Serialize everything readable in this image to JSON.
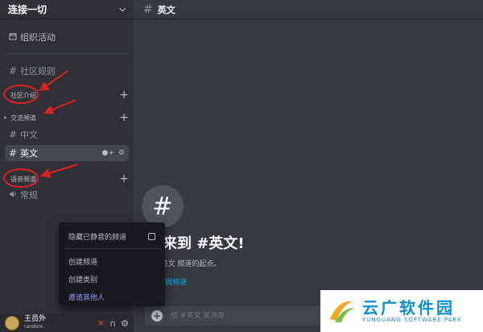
{
  "server": {
    "name": "连接一切"
  },
  "sidebar": {
    "events_label": "组织活动",
    "rules_channel": "社区规则",
    "categories": [
      {
        "label": "社区介绍"
      },
      {
        "label": "交流频道"
      },
      {
        "label": "语音频道"
      }
    ],
    "text_channels": [
      {
        "label": "中文"
      },
      {
        "label": "英文"
      }
    ],
    "voice_channel": "常规"
  },
  "user": {
    "name": "王员外",
    "tag": "random"
  },
  "context_menu": {
    "items": [
      {
        "label": "隐藏已静音的频道"
      },
      {
        "label": "创建频道"
      },
      {
        "label": "创建类别"
      },
      {
        "label": "邀请其他人"
      }
    ]
  },
  "main": {
    "channel_name": "英文",
    "welcome_title": "迎来到 #英文!",
    "welcome_subtitle": "#英文 频道的起点。",
    "edit_channel_link": "编辑频道",
    "message_placeholder": "给 #英文 发消息"
  },
  "watermark": {
    "cn": "云广软件园",
    "en": "YUNGUANG SOFTWARE PARK"
  },
  "colors": {
    "sidebar_bg": "#2f3136",
    "main_bg": "#36393f",
    "annotation_red": "#e02020",
    "link_blue": "#00aff4",
    "invite_purple": "#949cf7",
    "watermark_blue": "#0a8fd6"
  },
  "icons": {
    "events": "calendar-icon",
    "channel": "hash-icon",
    "voice": "speaker-icon",
    "add": "plus-icon",
    "invite": "add-member-icon",
    "settings": "gear-icon",
    "mic": "mic-muted-icon",
    "headphones": "headphones-icon"
  }
}
